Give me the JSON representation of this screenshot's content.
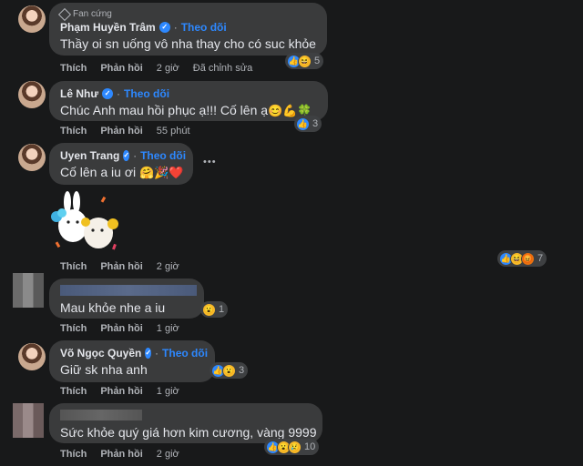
{
  "comments": [
    {
      "badge": "Fan cứng",
      "name": "Phạm Huyền Trâm",
      "follow": "Theo dõi",
      "text": "Thầy oi sn uống vô nha thay cho có suc khỏe",
      "actions": {
        "like": "Thích",
        "reply": "Phản hồi",
        "time": "2 giờ",
        "edited": "Đã chỉnh sửa"
      },
      "reaction_count": "5"
    },
    {
      "name": "Lê Như",
      "follow": "Theo dõi",
      "text": "Chúc Anh mau hồi phục ạ!!! Cố lên ạ",
      "text_emoji": "😊💪🍀",
      "actions": {
        "like": "Thích",
        "reply": "Phản hồi",
        "time": "55 phút"
      },
      "reaction_count": "3"
    },
    {
      "name": "Uyen Trang",
      "follow": "Theo dõi",
      "text": "Cố lên a iu ơi",
      "text_emoji": "🤗🎉❤️",
      "actions": {
        "like": "Thích",
        "reply": "Phản hồi",
        "time": "2 giờ"
      },
      "reaction_count": "7"
    },
    {
      "text": "Mau khỏe nhe a iu",
      "actions": {
        "like": "Thích",
        "reply": "Phản hồi",
        "time": "1 giờ"
      },
      "reaction_count": "1"
    },
    {
      "name": "Võ Ngọc Quyền",
      "follow": "Theo dõi",
      "text": "Giữ sk nha anh",
      "actions": {
        "like": "Thích",
        "reply": "Phản hồi",
        "time": "1 giờ"
      },
      "reaction_count": "3"
    },
    {
      "text": "Sức khỏe quý giá hơn kim cương, vàng 9999",
      "actions": {
        "like": "Thích",
        "reply": "Phản hồi",
        "time": "2 giờ"
      },
      "reaction_count": "10"
    }
  ],
  "more_menu": "•••",
  "colors": {
    "background": "#18191a",
    "bubble": "#3a3b3c",
    "link": "#2d88ff",
    "muted": "#b0b3b8"
  },
  "icons": [
    "verified-badge-icon",
    "fan-badge-icon",
    "like-reaction-icon",
    "haha-reaction-icon",
    "wow-reaction-icon",
    "angry-reaction-icon",
    "more-options-icon"
  ]
}
